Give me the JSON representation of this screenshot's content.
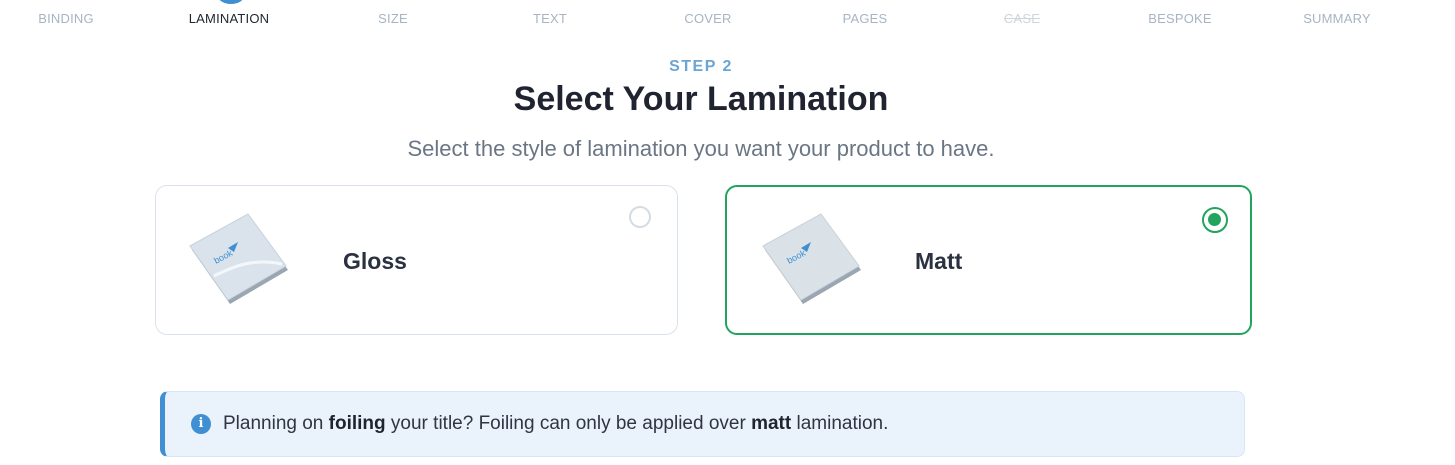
{
  "stepper": {
    "steps": [
      {
        "label": "BINDING",
        "state": "default"
      },
      {
        "label": "LAMINATION",
        "state": "active"
      },
      {
        "label": "SIZE",
        "state": "default"
      },
      {
        "label": "TEXT",
        "state": "default"
      },
      {
        "label": "COVER",
        "state": "default"
      },
      {
        "label": "PAGES",
        "state": "default"
      },
      {
        "label": "CASE",
        "state": "disabled"
      },
      {
        "label": "BESPOKE",
        "state": "default"
      },
      {
        "label": "SUMMARY",
        "state": "default"
      }
    ]
  },
  "header": {
    "step_label": "STEP 2",
    "title": "Select Your Lamination",
    "subtitle": "Select the style of lamination you want your product to have."
  },
  "options": [
    {
      "label": "Gloss",
      "selected": false
    },
    {
      "label": "Matt",
      "selected": true
    }
  ],
  "alert": {
    "icon": "info-icon",
    "text_1": "Planning on ",
    "text_bold_1": "foiling",
    "text_2": " your title? Foiling can only be applied over ",
    "text_bold_2": "matt",
    "text_3": " lamination."
  },
  "colors": {
    "accent_blue": "#3f8fd2",
    "selected_green": "#22a45d",
    "alert_bg": "#eaf3fb"
  }
}
